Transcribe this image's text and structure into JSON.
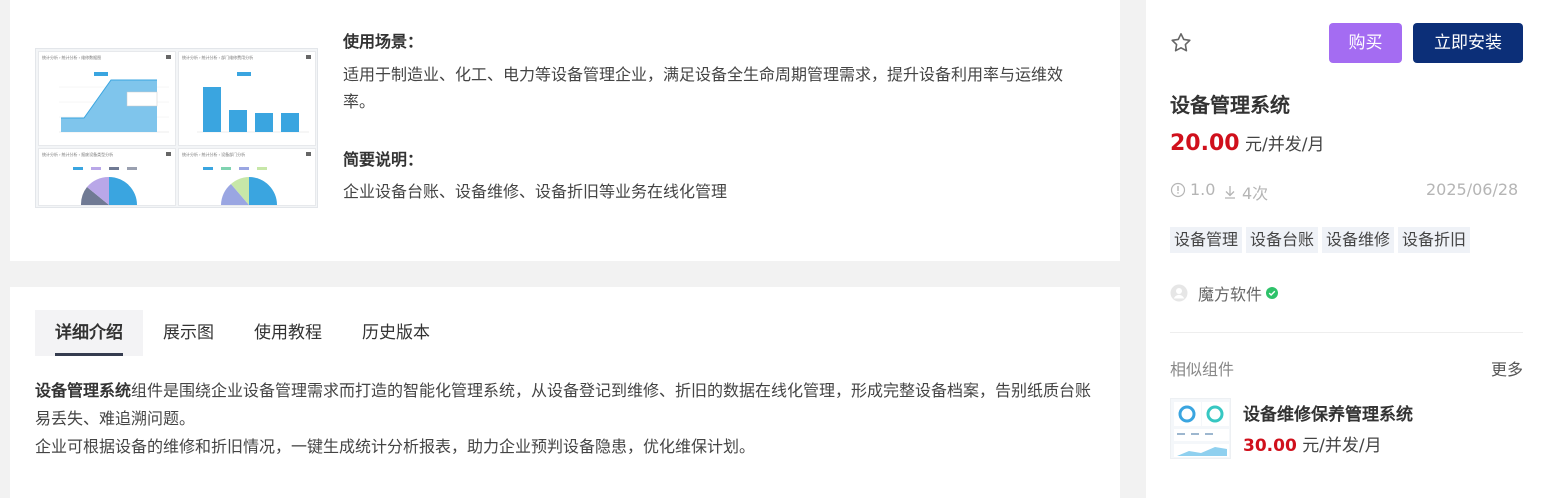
{
  "detail_card": {
    "scene_title": "使用场景：",
    "scene_text": "适用于制造业、化工、电力等设备管理企业，满足设备全生命周期管理需求，提升设备利用率与运维效率。",
    "brief_title": "简要说明：",
    "brief_text": "企业设备台账、设备维修、设备折旧等业务在线化管理"
  },
  "tabs": [
    {
      "label": "详细介绍",
      "active": true
    },
    {
      "label": "展示图",
      "active": false
    },
    {
      "label": "使用教程",
      "active": false
    },
    {
      "label": "历史版本",
      "active": false
    }
  ],
  "detail": {
    "product_bold": "设备管理系统",
    "para1_rest": "组件是围绕企业设备管理需求而打造的智能化管理系统，从设备登记到维修、折旧的数据在线化管理，形成完整设备档案，告别纸质台账易丢失、难追溯问题。",
    "para2": "企业可根据设备的维修和折旧情况，一键生成统计分析报表，助力企业预判设备隐患，优化维保计划。"
  },
  "product": {
    "buy_label": "购买",
    "install_label": "立即安装",
    "title": "设备管理系统",
    "price": "20.00",
    "price_unit": "元/并发/月",
    "version": "1.0",
    "downloads": "4次",
    "date": "2025/06/28",
    "tags": [
      "设备管理",
      "设备台账",
      "设备维修",
      "设备折旧"
    ],
    "vendor": "魔方软件"
  },
  "similar": {
    "heading": "相似组件",
    "more_label": "更多",
    "items": [
      {
        "title": "设备维修保养管理系统",
        "price": "30.00",
        "price_unit": "元/并发/月"
      }
    ]
  },
  "colors": {
    "buy": "#a46cf2",
    "install": "#0c2f78",
    "price": "#d0101c",
    "verified": "#2ec26a"
  }
}
